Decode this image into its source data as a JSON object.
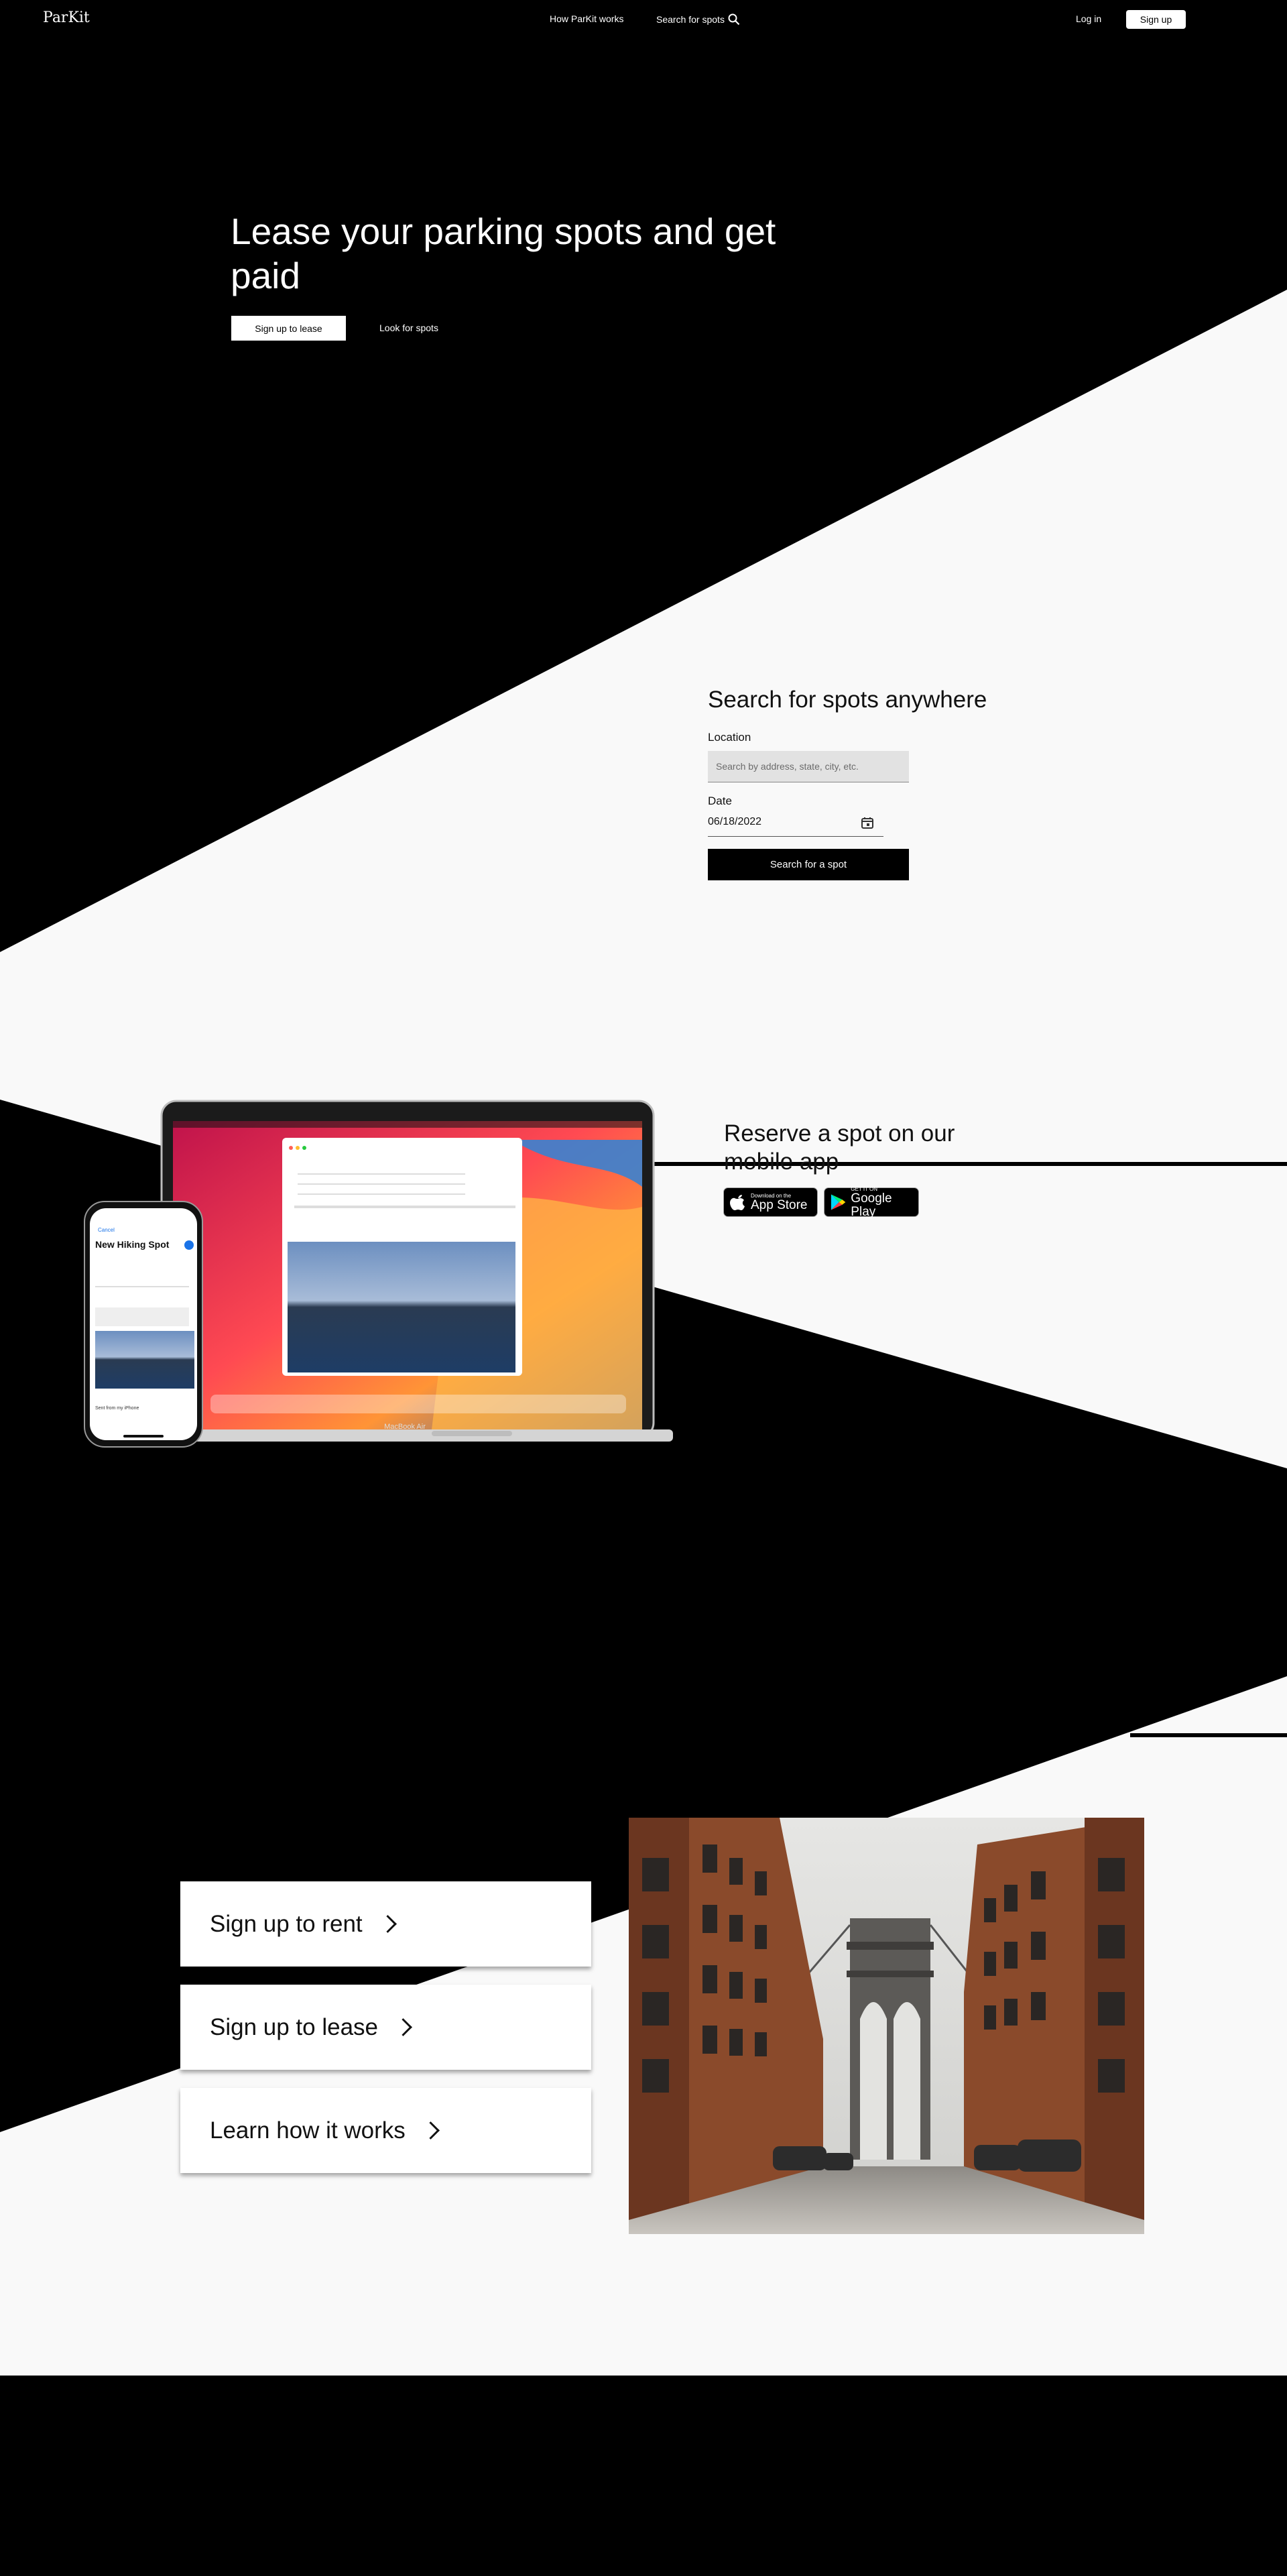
{
  "header": {
    "logo": "ParKit",
    "nav": {
      "how_it_works": "How ParKit works",
      "search_for_spots": "Search for spots"
    },
    "login": "Log in",
    "signup": "Sign up"
  },
  "hero": {
    "title": "Lease your parking spots and get paid",
    "primary_cta": "Sign up to lease",
    "secondary_cta": "Look for spots"
  },
  "search": {
    "title": "Search for spots anywhere",
    "location_label": "Location",
    "location_placeholder": "Search by address, state, city, etc.",
    "date_label": "Date",
    "date_value": "06/18/2022",
    "button": "Search for a spot"
  },
  "mobile_app": {
    "title": "Reserve a spot on our mobile app",
    "app_store": {
      "small": "Download on the",
      "big": "App Store"
    },
    "google_play": {
      "small": "GET IT ON",
      "big": "Google Play"
    },
    "device_mock": {
      "laptop_label": "MacBook Air",
      "email_subject": "New Hiking Spot",
      "phone_title": "New Hiking Spot",
      "phone_cancel": "Cancel",
      "phone_signature": "Sent from my iPhone"
    }
  },
  "cta_cards": [
    {
      "label": "Sign up to rent"
    },
    {
      "label": "Sign up to lease"
    },
    {
      "label": "Learn how it works"
    }
  ],
  "colors": {
    "dark": "#000000",
    "light": "#f9f9f9",
    "white": "#ffffff",
    "input_bg": "#e2e2e2"
  }
}
